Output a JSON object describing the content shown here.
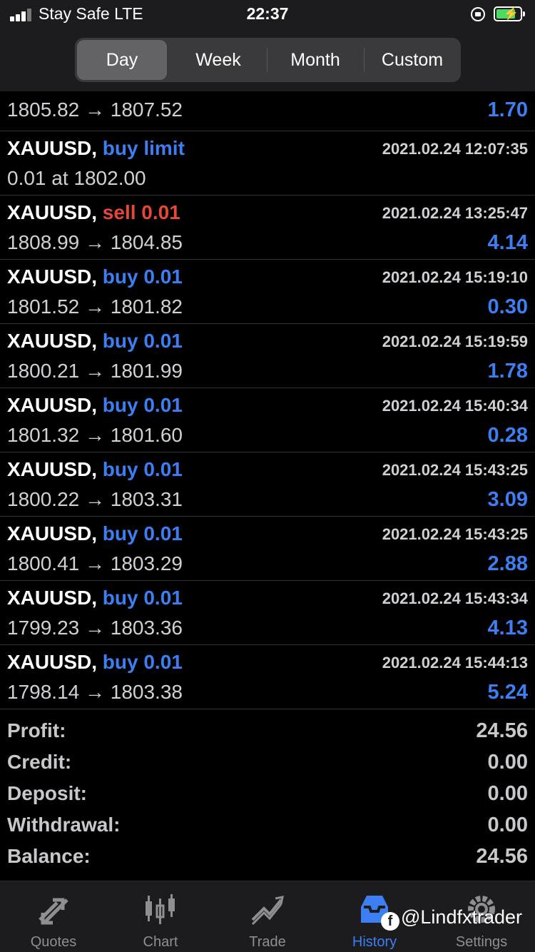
{
  "status_bar": {
    "carrier": "Stay Safe  LTE",
    "time": "22:37"
  },
  "period_tabs": [
    {
      "label": "Day",
      "active": true
    },
    {
      "label": "Week",
      "active": false
    },
    {
      "label": "Month",
      "active": false
    },
    {
      "label": "Custom",
      "active": false
    }
  ],
  "partial_row": {
    "prices": "1805.82 → 1807.52",
    "profit": "1.70"
  },
  "deals": [
    {
      "symbol": "XAUUSD,",
      "action": "buy limit",
      "side": "buy",
      "time": "2021.02.24 12:07:35",
      "details": "0.01 at 1802.00",
      "profit": ""
    },
    {
      "symbol": "XAUUSD,",
      "action": "sell 0.01",
      "side": "sell",
      "time": "2021.02.24 13:25:47",
      "details": "1808.99 → 1804.85",
      "profit": "4.14"
    },
    {
      "symbol": "XAUUSD,",
      "action": "buy 0.01",
      "side": "buy",
      "time": "2021.02.24 15:19:10",
      "details": "1801.52 → 1801.82",
      "profit": "0.30"
    },
    {
      "symbol": "XAUUSD,",
      "action": "buy 0.01",
      "side": "buy",
      "time": "2021.02.24 15:19:59",
      "details": "1800.21 → 1801.99",
      "profit": "1.78"
    },
    {
      "symbol": "XAUUSD,",
      "action": "buy 0.01",
      "side": "buy",
      "time": "2021.02.24 15:40:34",
      "details": "1801.32 → 1801.60",
      "profit": "0.28"
    },
    {
      "symbol": "XAUUSD,",
      "action": "buy 0.01",
      "side": "buy",
      "time": "2021.02.24 15:43:25",
      "details": "1800.22 → 1803.31",
      "profit": "3.09"
    },
    {
      "symbol": "XAUUSD,",
      "action": "buy 0.01",
      "side": "buy",
      "time": "2021.02.24 15:43:25",
      "details": "1800.41 → 1803.29",
      "profit": "2.88"
    },
    {
      "symbol": "XAUUSD,",
      "action": "buy 0.01",
      "side": "buy",
      "time": "2021.02.24 15:43:34",
      "details": "1799.23 → 1803.36",
      "profit": "4.13"
    },
    {
      "symbol": "XAUUSD,",
      "action": "buy 0.01",
      "side": "buy",
      "time": "2021.02.24 15:44:13",
      "details": "1798.14 → 1803.38",
      "profit": "5.24"
    }
  ],
  "summary": [
    {
      "label": "Profit:",
      "value": "24.56"
    },
    {
      "label": "Credit:",
      "value": "0.00"
    },
    {
      "label": "Deposit:",
      "value": "0.00"
    },
    {
      "label": "Withdrawal:",
      "value": "0.00"
    },
    {
      "label": "Balance:",
      "value": "24.56"
    }
  ],
  "tabbar": [
    {
      "label": "Quotes",
      "icon": "quotes-icon",
      "active": false
    },
    {
      "label": "Chart",
      "icon": "chart-icon",
      "active": false
    },
    {
      "label": "Trade",
      "icon": "trade-icon",
      "active": false
    },
    {
      "label": "History",
      "icon": "history-icon",
      "active": true
    },
    {
      "label": "Settings",
      "icon": "settings-icon",
      "active": false
    }
  ],
  "watermark": "@Lindfxtrader",
  "colors": {
    "buy": "#3d7ff2",
    "sell": "#e8463a",
    "active_tab": "#3d7ff2",
    "battery": "#4cd964"
  }
}
